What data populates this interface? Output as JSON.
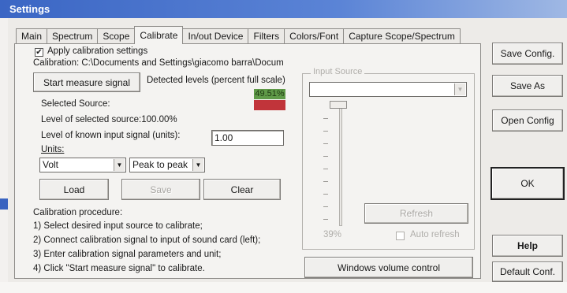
{
  "window": {
    "title": "Settings"
  },
  "tabs": [
    {
      "label": "Main"
    },
    {
      "label": "Spectrum"
    },
    {
      "label": "Scope"
    },
    {
      "label": "Calibrate",
      "active": true
    },
    {
      "label": "In/out Device"
    },
    {
      "label": "Filters"
    },
    {
      "label": "Colors/Font"
    },
    {
      "label": "Capture Scope/Spectrum"
    }
  ],
  "calibrate": {
    "apply_checkbox_label": "Apply calibration settings",
    "apply_checked": true,
    "calibration_path": "Calibration: C:\\Documents and Settings\\giacomo barra\\Docum",
    "start_button": "Start measure signal",
    "detected_levels_label": "Detected levels (percent full scale)",
    "detected_level_value": "49.51%",
    "level_colors": {
      "text_bg": "#5f9a48",
      "bar": "#c1343a"
    },
    "selected_source_label": "Selected Source:",
    "level_selected_source": "Level of selected source:100.00%",
    "known_input_label": "Level of known input signal (units):",
    "known_input_value": "1.00",
    "units_label": "Units:",
    "unit_select_value": "Volt",
    "measure_select_value": "Peak to peak",
    "load_button": "Load",
    "save_button": "Save",
    "clear_button": "Clear",
    "procedure_title": "Calibration procedure:",
    "procedure_steps": [
      "1) Select desired input source to calibrate;",
      "2) Connect calibration signal to input of sound card (left);",
      "3) Enter calibration signal parameters and unit;",
      "4) Click \"Start measure signal\" to calibrate."
    ]
  },
  "input_source": {
    "legend": "Input Source",
    "select_value": "",
    "slider_value_label": "39%",
    "refresh_button": "Refresh",
    "auto_refresh_label": "Auto refresh",
    "auto_refresh_checked": false,
    "windows_volume_button": "Windows volume control"
  },
  "right_buttons": {
    "save_config": "Save Config.",
    "save_as": "Save As",
    "open_config": "Open Config",
    "ok": "OK",
    "help": "Help",
    "default_conf": "Default Conf."
  }
}
